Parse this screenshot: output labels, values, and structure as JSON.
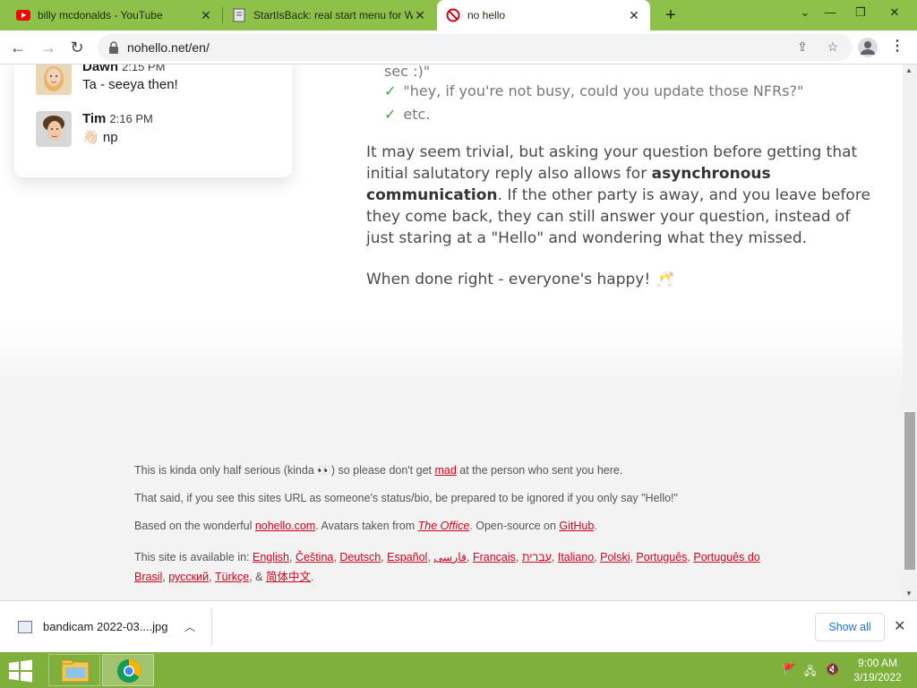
{
  "tabs": [
    {
      "title": "billy mcdonalds - YouTube",
      "favicon": "youtube-icon"
    },
    {
      "title": "StartIsBack: real start menu for W",
      "favicon": "document-icon"
    },
    {
      "title": "no hello",
      "favicon": "no-sign-icon"
    }
  ],
  "colors": {
    "tabstrip": "#8dc14a",
    "taskbar": "#7fb03c",
    "link": "#d0021b",
    "check": "#3aa34a",
    "showall": "#1a73e8"
  },
  "toolbar": {
    "url": "nohello.net/en/"
  },
  "chat": {
    "messages": [
      {
        "name": "Dawn",
        "time": "2:15 PM",
        "text": "Ta - seeya then!"
      },
      {
        "name": "Tim",
        "time": "2:16 PM",
        "text": "np",
        "emoji": "👋🏻"
      }
    ]
  },
  "article": {
    "fragment": "sec :)\"",
    "checks": [
      "\"hey, if you're not busy, could you update those NFRs?\"",
      "etc."
    ],
    "para1_a": "It may seem trivial, but asking your question before getting that initial salutatory reply also allows for ",
    "para1_bold": "asynchronous communication",
    "para1_b": ". If the other party is away, and you leave before they come back, they can still answer your question, instead of just staring at a \"Hello\" and wondering what they missed.",
    "para2": "When done right - everyone's happy! 🥂"
  },
  "footer": {
    "line1_a": "This is kinda only half serious (kinda 👀) so please don't get ",
    "line1_link": "mad",
    "line1_b": " at the person who sent you here.",
    "line2": "That said, if you see this sites URL as someone's status/bio, be prepared to be ignored if you only say \"Hello!\"",
    "line3_a": "Based on the wonderful ",
    "line3_link1": "nohello.com",
    "line3_b": ". Avatars taken from ",
    "line3_link2": "The Office",
    "line3_c": ". Open-source on ",
    "line3_link3": "GitHub",
    "line3_d": ".",
    "line4_prefix": "This site is available in: ",
    "languages": [
      "English",
      "Čeština",
      "Deutsch",
      "Español",
      "فارسی",
      "Français",
      "עברית",
      "Italiano",
      "Polski",
      "Português",
      "Português do Brasil",
      "русский",
      "Türkçe",
      "简体中文"
    ]
  },
  "downloads": {
    "file_name": "bandicam 2022-03....jpg",
    "show_all": "Show all"
  },
  "taskbar": {
    "time": "9:00 AM",
    "date": "3/19/2022"
  }
}
